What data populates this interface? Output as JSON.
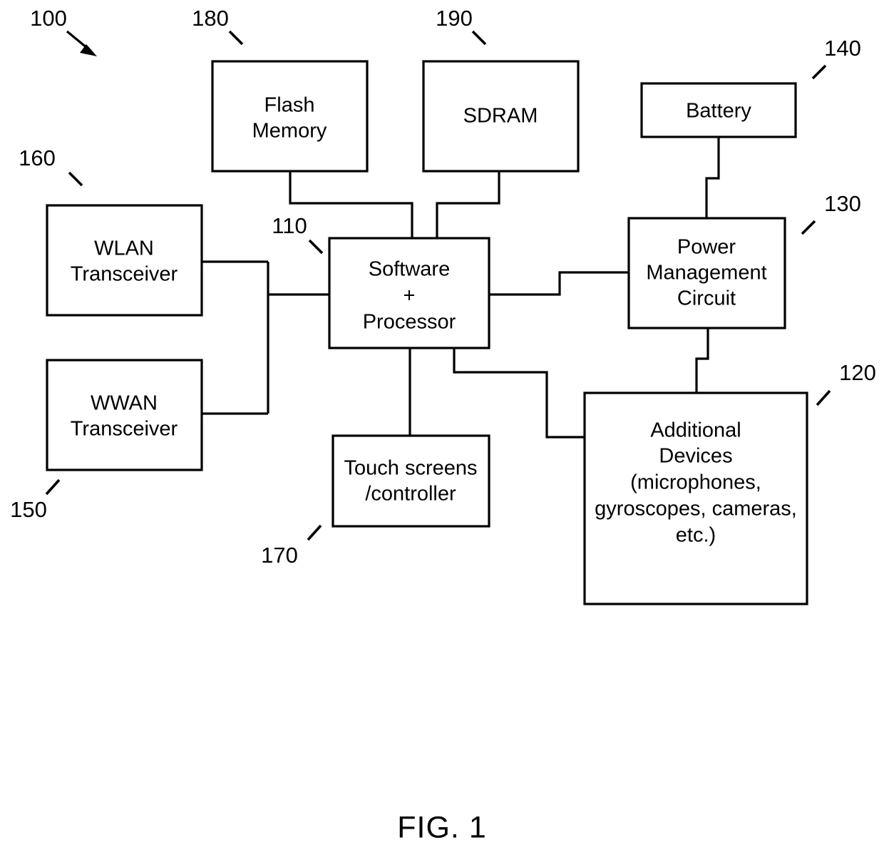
{
  "figure": {
    "caption": "FIG. 1",
    "system_ref": "100"
  },
  "blocks": [
    {
      "id": "flash-memory",
      "ref": "180",
      "lines": [
        "Flash",
        "Memory"
      ]
    },
    {
      "id": "sdram",
      "ref": "190",
      "lines": [
        "SDRAM"
      ]
    },
    {
      "id": "battery",
      "ref": "140",
      "lines": [
        "Battery"
      ]
    },
    {
      "id": "wlan-transceiver",
      "ref": "160",
      "lines": [
        "WLAN",
        "Transceiver"
      ]
    },
    {
      "id": "wwan-transceiver",
      "ref": "150",
      "lines": [
        "WWAN",
        "Transceiver"
      ]
    },
    {
      "id": "software-processor",
      "ref": "110",
      "lines": [
        "Software",
        "+",
        "Processor"
      ]
    },
    {
      "id": "power-management-circuit",
      "ref": "130",
      "lines": [
        "Power",
        "Management",
        "Circuit"
      ]
    },
    {
      "id": "touch-screens-controller",
      "ref": "170",
      "lines": [
        "Touch screens",
        "/controller"
      ]
    },
    {
      "id": "additional-devices",
      "ref": "120",
      "lines": [
        "Additional",
        "Devices",
        "(microphones,",
        "gyroscopes, cameras,",
        "etc.)"
      ]
    }
  ],
  "text": {
    "flash_memory_l1": "Flash",
    "flash_memory_l2": "Memory",
    "sdram_l1": "SDRAM",
    "battery_l1": "Battery",
    "wlan_l1": "WLAN",
    "wlan_l2": "Transceiver",
    "wwan_l1": "WWAN",
    "wwan_l2": "Transceiver",
    "processor_l1": "Software",
    "processor_l2": "+",
    "processor_l3": "Processor",
    "pmc_l1": "Power",
    "pmc_l2": "Management",
    "pmc_l3": "Circuit",
    "touch_l1": "Touch screens",
    "touch_l2": "/controller",
    "devices_l1": "Additional",
    "devices_l2": "Devices",
    "devices_l3": "(microphones,",
    "devices_l4": "gyroscopes, cameras,",
    "devices_l5": "etc.)"
  },
  "refs": {
    "system": "100",
    "flash_memory": "180",
    "sdram": "190",
    "battery": "140",
    "power_management": "130",
    "additional_devices": "120",
    "wlan": "160",
    "wwan": "150",
    "processor": "110",
    "touch_screens": "170"
  },
  "colors": {
    "stroke": "#000000",
    "background": "#ffffff",
    "text": "#000000"
  },
  "connections": [
    {
      "from": "flash-memory",
      "to": "software-processor"
    },
    {
      "from": "sdram",
      "to": "software-processor"
    },
    {
      "from": "battery",
      "to": "power-management-circuit"
    },
    {
      "from": "wlan-transceiver",
      "to": "software-processor"
    },
    {
      "from": "wwan-transceiver",
      "to": "software-processor"
    },
    {
      "from": "software-processor",
      "to": "power-management-circuit"
    },
    {
      "from": "software-processor",
      "to": "touch-screens-controller"
    },
    {
      "from": "software-processor",
      "to": "additional-devices"
    },
    {
      "from": "power-management-circuit",
      "to": "additional-devices"
    }
  ]
}
